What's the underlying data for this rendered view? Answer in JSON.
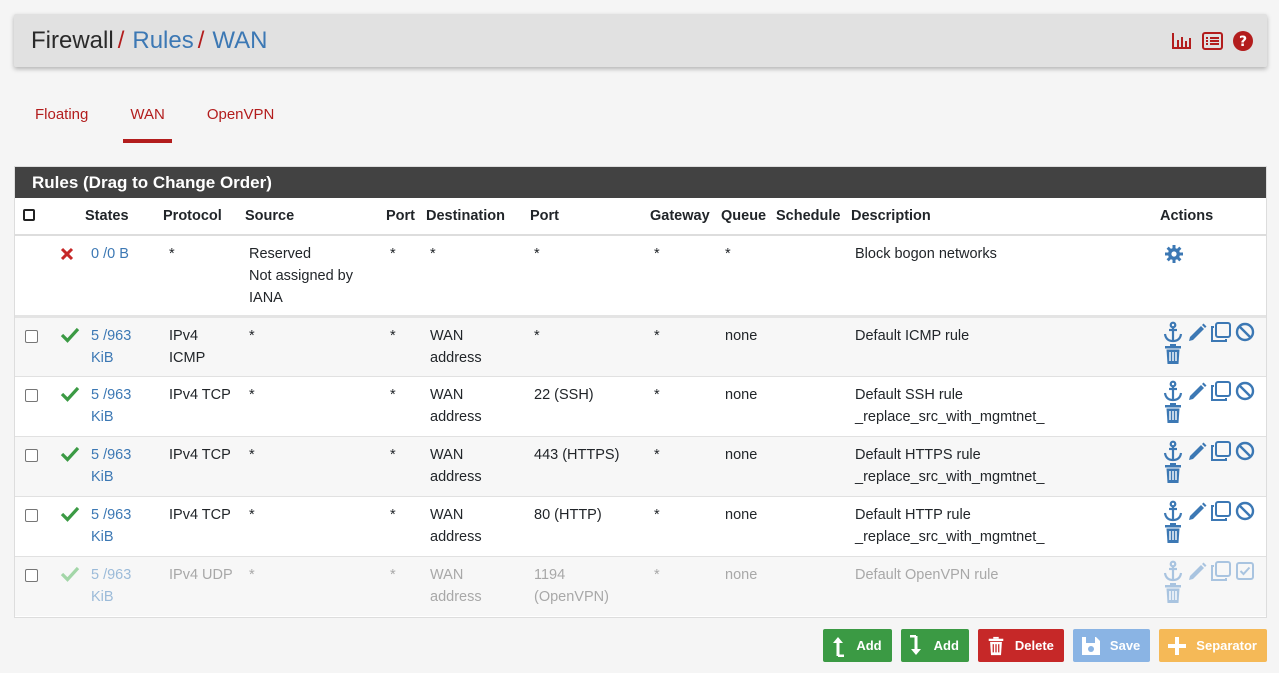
{
  "breadcrumb": {
    "first": "Firewall",
    "second": "Rules",
    "third": "WAN",
    "sep": "/"
  },
  "header_icons": [
    "chart-icon",
    "list-icon",
    "help-icon"
  ],
  "tabs": [
    {
      "label": "Floating",
      "active": false
    },
    {
      "label": "WAN",
      "active": true
    },
    {
      "label": "OpenVPN",
      "active": false
    }
  ],
  "panel": {
    "title": "Rules (Drag to Change Order)",
    "columns": [
      "States",
      "Protocol",
      "Source",
      "Port",
      "Destination",
      "Port",
      "Gateway",
      "Queue",
      "Schedule",
      "Description",
      "Actions"
    ]
  },
  "rules": [
    {
      "status": "blocked",
      "states_a": "0 /0 B",
      "states_b": "",
      "protocol_a": "*",
      "protocol_b": "",
      "source_a": "Reserved",
      "source_b": "Not assigned by",
      "source_c": "IANA",
      "sport": "*",
      "dest_a": "*",
      "dest_b": "",
      "dport_a": "*",
      "dport_b": "",
      "gateway": "*",
      "queue": "*",
      "schedule": "",
      "desc_a": "Block bogon networks",
      "desc_b": ""
    },
    {
      "status": "pass",
      "states_a": "5 /963",
      "states_b": "KiB",
      "protocol_a": "IPv4",
      "protocol_b": "ICMP",
      "source_a": "*",
      "source_b": "",
      "source_c": "",
      "sport": "*",
      "dest_a": "WAN",
      "dest_b": "address",
      "dport_a": "*",
      "dport_b": "",
      "gateway": "*",
      "queue": "none",
      "schedule": "",
      "desc_a": "Default ICMP rule",
      "desc_b": ""
    },
    {
      "status": "pass",
      "states_a": "5 /963",
      "states_b": "KiB",
      "protocol_a": "IPv4 TCP",
      "protocol_b": "",
      "source_a": "*",
      "source_b": "",
      "source_c": "",
      "sport": "*",
      "dest_a": "WAN",
      "dest_b": "address",
      "dport_a": "22 (SSH)",
      "dport_b": "",
      "gateway": "*",
      "queue": "none",
      "schedule": "",
      "desc_a": "Default SSH rule",
      "desc_b": "_replace_src_with_mgmtnet_"
    },
    {
      "status": "pass",
      "states_a": "5 /963",
      "states_b": "KiB",
      "protocol_a": "IPv4 TCP",
      "protocol_b": "",
      "source_a": "*",
      "source_b": "",
      "source_c": "",
      "sport": "*",
      "dest_a": "WAN",
      "dest_b": "address",
      "dport_a": "443 (HTTPS)",
      "dport_b": "",
      "gateway": "*",
      "queue": "none",
      "schedule": "",
      "desc_a": "Default HTTPS rule",
      "desc_b": "_replace_src_with_mgmtnet_"
    },
    {
      "status": "pass",
      "states_a": "5 /963",
      "states_b": "KiB",
      "protocol_a": "IPv4 TCP",
      "protocol_b": "",
      "source_a": "*",
      "source_b": "",
      "source_c": "",
      "sport": "*",
      "dest_a": "WAN",
      "dest_b": "address",
      "dport_a": "80 (HTTP)",
      "dport_b": "",
      "gateway": "*",
      "queue": "none",
      "schedule": "",
      "desc_a": "Default HTTP rule",
      "desc_b": "_replace_src_with_mgmtnet_"
    },
    {
      "status": "disabled",
      "states_a": "5 /963",
      "states_b": "KiB",
      "protocol_a": "IPv4 UDP",
      "protocol_b": "",
      "source_a": "*",
      "source_b": "",
      "source_c": "",
      "sport": "*",
      "dest_a": "WAN",
      "dest_b": "address",
      "dport_a": "1194",
      "dport_b": "(OpenVPN)",
      "gateway": "*",
      "queue": "none",
      "schedule": "",
      "desc_a": "Default OpenVPN rule",
      "desc_b": ""
    }
  ],
  "buttons": {
    "add_top": "Add",
    "add_bottom": "Add",
    "delete": "Delete",
    "save": "Save",
    "separator": "Separator"
  },
  "colors": {
    "accent_red": "#b31d1d",
    "link_blue": "#3c78b4",
    "pass_green": "#3b9a44",
    "panel_dark": "#424242"
  }
}
